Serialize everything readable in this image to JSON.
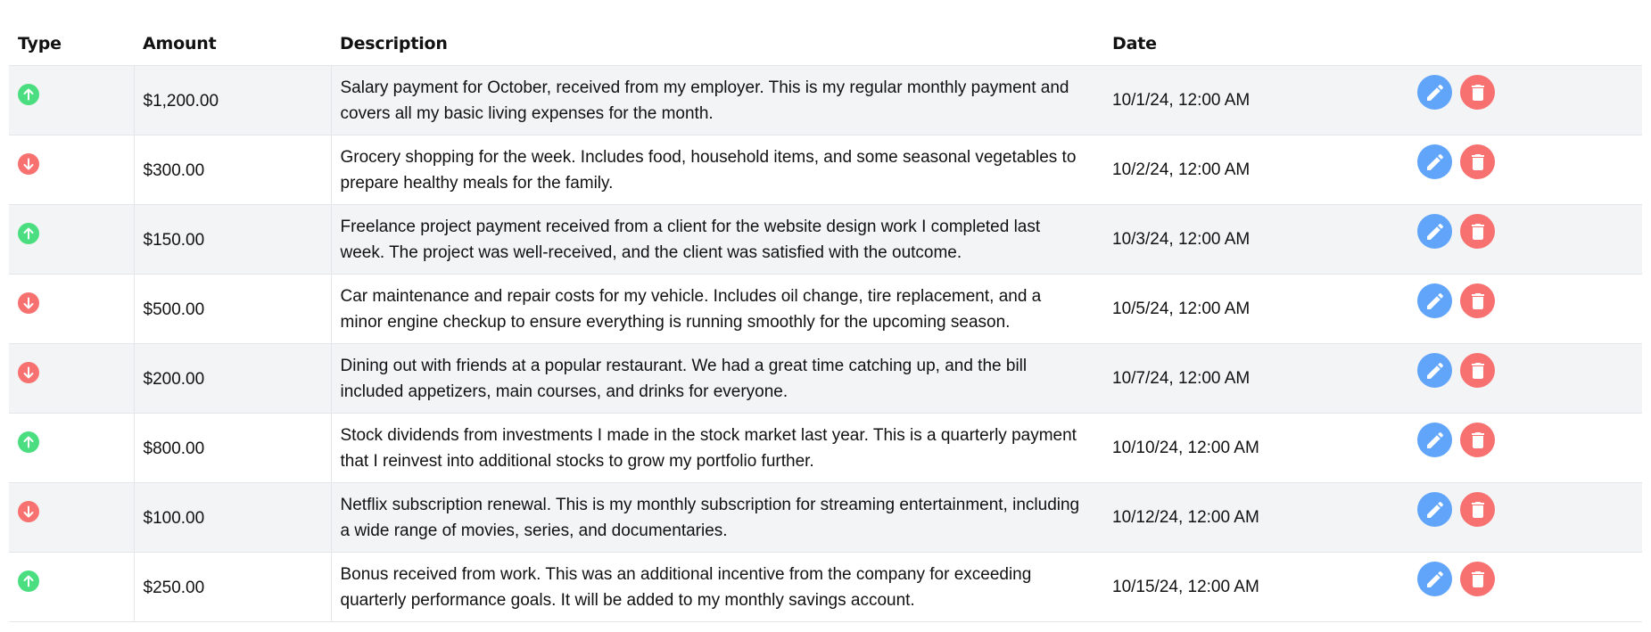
{
  "header": {
    "type": "Type",
    "amount": "Amount",
    "description": "Description",
    "date": "Date"
  },
  "colors": {
    "income": "#4ade80",
    "expense": "#f87171",
    "edit": "#60a5fa",
    "delete": "#f87171",
    "row_alt": "#f3f4f6"
  },
  "transactions": [
    {
      "type": "income",
      "icon": "arrow-up-icon",
      "amount": "$1,200.00",
      "description": "Salary payment for October, received from my employer. This is my regular monthly payment and covers all my basic living expenses for the month.",
      "date": "10/1/24, 12:00 AM"
    },
    {
      "type": "expense",
      "icon": "arrow-down-icon",
      "amount": "$300.00",
      "description": "Grocery shopping for the week. Includes food, household items, and some seasonal vegetables to prepare healthy meals for the family.",
      "date": "10/2/24, 12:00 AM"
    },
    {
      "type": "income",
      "icon": "arrow-up-icon",
      "amount": "$150.00",
      "description": "Freelance project payment received from a client for the website design work I completed last week. The project was well-received, and the client was satisfied with the outcome.",
      "date": "10/3/24, 12:00 AM"
    },
    {
      "type": "expense",
      "icon": "arrow-down-icon",
      "amount": "$500.00",
      "description": "Car maintenance and repair costs for my vehicle. Includes oil change, tire replacement, and a minor engine checkup to ensure everything is running smoothly for the upcoming season.",
      "date": "10/5/24, 12:00 AM"
    },
    {
      "type": "expense",
      "icon": "arrow-down-icon",
      "amount": "$200.00",
      "description": "Dining out with friends at a popular restaurant. We had a great time catching up, and the bill included appetizers, main courses, and drinks for everyone.",
      "date": "10/7/24, 12:00 AM"
    },
    {
      "type": "income",
      "icon": "arrow-up-icon",
      "amount": "$800.00",
      "description": "Stock dividends from investments I made in the stock market last year. This is a quarterly payment that I reinvest into additional stocks to grow my portfolio further.",
      "date": "10/10/24, 12:00 AM"
    },
    {
      "type": "expense",
      "icon": "arrow-down-icon",
      "amount": "$100.00",
      "description": "Netflix subscription renewal. This is my monthly subscription for streaming entertainment, including a wide range of movies, series, and documentaries.",
      "date": "10/12/24, 12:00 AM"
    },
    {
      "type": "income",
      "icon": "arrow-up-icon",
      "amount": "$250.00",
      "description": "Bonus received from work. This was an additional incentive from the company for exceeding quarterly performance goals. It will be added to my monthly savings account.",
      "date": "10/15/24, 12:00 AM"
    }
  ]
}
